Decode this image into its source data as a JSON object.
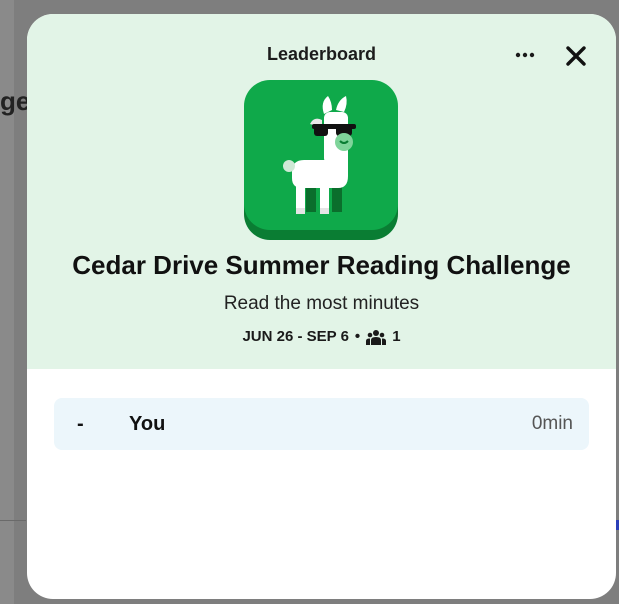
{
  "background": {
    "peek_text": "ge"
  },
  "header": {
    "title": "Leaderboard",
    "more_icon": "more-horizontal-icon",
    "close_icon": "close-icon"
  },
  "challenge": {
    "badge_icon": "llama-with-sunglasses-icon",
    "title": "Cedar Drive Summer Reading Challenge",
    "subtitle": "Read the most minutes",
    "dates": "JUN 26 - SEP 6",
    "separator": "•",
    "participants_icon": "people-icon",
    "participants": "1"
  },
  "leaderboard": {
    "rows": [
      {
        "rank": "-",
        "name": "You",
        "minutes": "0min"
      }
    ]
  },
  "colors": {
    "hero_bg": "#e2f4e7",
    "badge_green": "#0fa94a",
    "badge_dark_green": "#0a7d33",
    "row_bg": "#ecf6fb",
    "overlay": "#7e7e7e"
  }
}
